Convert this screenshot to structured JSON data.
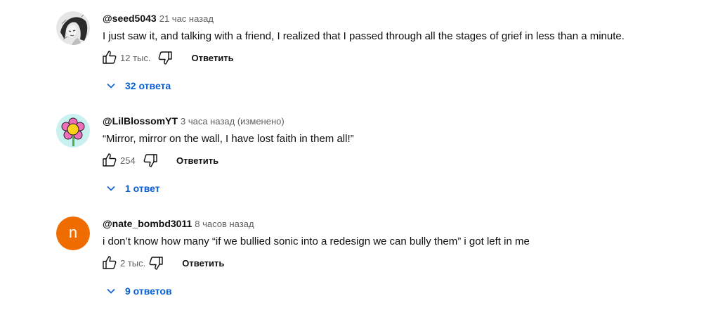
{
  "comments": [
    {
      "author": "@seed5043",
      "time": "21 час назад",
      "text": "I just saw it, and talking with a friend, I realized that I passed through all the stages of grief in less than a minute.",
      "likes": "12 тыс.",
      "reply_label": "Ответить",
      "replies_label": "32 ответа",
      "avatar_type": "sketch"
    },
    {
      "author": "@LilBlossomYT",
      "time": "3 часа назад (изменено)",
      "text": "“Mirror, mirror on the wall, I have lost faith in them all!”",
      "likes": "254",
      "reply_label": "Ответить",
      "replies_label": "1 ответ",
      "avatar_type": "flower"
    },
    {
      "author": "@nate_bombd3011",
      "time": "8 часов назад",
      "text": "i don’t know how many “if we bullied sonic into a redesign we can bully them” i got left in me",
      "likes": "2 тыс.",
      "reply_label": "Ответить",
      "replies_label": "9 ответов",
      "avatar_type": "letter",
      "avatar_letter": "n",
      "avatar_color": "#ef6c00"
    }
  ],
  "colors": {
    "link": "#065fd4",
    "meta": "#606060",
    "text": "#0f0f0f"
  },
  "icons": {
    "like": "thumbs-up-icon",
    "dislike": "thumbs-down-icon",
    "expand": "chevron-down-icon"
  }
}
